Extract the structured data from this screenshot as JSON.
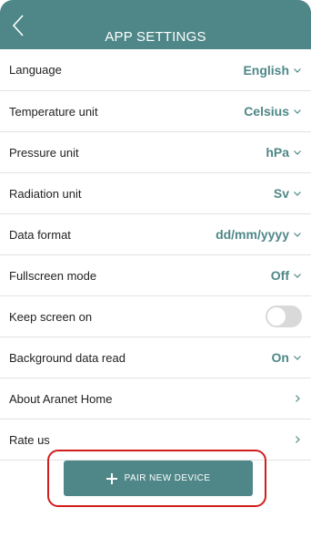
{
  "header": {
    "title": "APP SETTINGS",
    "back_icon": "chevron-left-icon"
  },
  "settings": [
    {
      "label": "Language",
      "value": "English",
      "control": "dropdown"
    },
    {
      "label": "Temperature unit",
      "value": "Celsius",
      "control": "dropdown"
    },
    {
      "label": "Pressure unit",
      "value": "hPa",
      "control": "dropdown"
    },
    {
      "label": "Radiation unit",
      "value": "Sv",
      "control": "dropdown"
    },
    {
      "label": "Data format",
      "value": "dd/mm/yyyy",
      "control": "dropdown"
    },
    {
      "label": "Fullscreen mode",
      "value": "Off",
      "control": "dropdown"
    },
    {
      "label": "Keep screen on",
      "value": "",
      "control": "toggle",
      "toggle_on": false
    },
    {
      "label": "Background data read",
      "value": "On",
      "control": "dropdown"
    },
    {
      "label": "About Aranet Home",
      "value": "",
      "control": "link"
    },
    {
      "label": "Rate us",
      "value": "",
      "control": "link"
    }
  ],
  "pair_button": {
    "label": "PAIR NEW DEVICE",
    "icon": "plus-icon"
  },
  "colors": {
    "accent": "#4f8788",
    "highlight": "#d21d1d"
  }
}
